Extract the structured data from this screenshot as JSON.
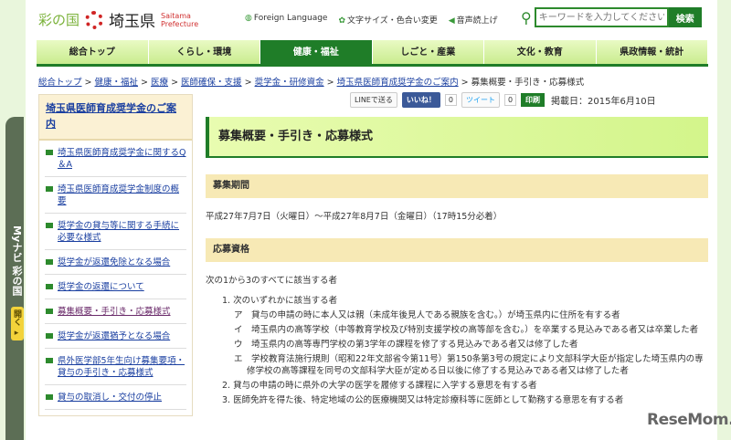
{
  "header": {
    "logo_a": "彩の国",
    "logo_b": "埼玉県",
    "logo_c1": "Saitama",
    "logo_c2": "Prefecture",
    "links": [
      "Foreign Language",
      "文字サイズ・色合い変更",
      "音声読上げ"
    ],
    "search_placeholder": "キーワードを入力してください",
    "search_button": "検索"
  },
  "mynavi": {
    "label": "Myナビ 彩の国",
    "open": "開く ▸"
  },
  "nav": [
    "総合トップ",
    "くらし・環境",
    "健康・福祉",
    "しごと・産業",
    "文化・教育",
    "県政情報・統計"
  ],
  "breadcrumb": [
    "総合トップ",
    "健康・福祉",
    "医療",
    "医師確保・支援",
    "奨学金・研修資金",
    "埼玉県医師育成奨学金のご案内"
  ],
  "breadcrumb_current": "募集概要・手引き・応募様式",
  "share": {
    "line": "LINEで送る",
    "like": "いいね！",
    "like_count": "0",
    "tweet": "ツイート",
    "tweet_count": "0",
    "print": "印刷",
    "date": "掲載日：2015年6月10日"
  },
  "sidebar": {
    "title": "埼玉県医師育成奨学金のご案内",
    "items": [
      "埼玉県医師育成奨学金に関するQ＆A",
      "埼玉県医師育成奨学金制度の概要",
      "奨学金の貸与等に関する手続に必要な様式",
      "奨学金が返還免除となる場合",
      "奨学金の返還について",
      "募集概要・手引き・応募様式",
      "奨学金が返還猶予となる場合",
      "県外医学部5年生向け募集要項・貸与の手引き・応募様式",
      "貸与の取消し・交付の停止"
    ]
  },
  "main": {
    "title": "募集概要・手引き・応募様式",
    "s1": "募集期間",
    "period": "平成27年7月7日（火曜日）～平成27年8月7日（金曜日）（17時15分必着）",
    "s2": "応募資格",
    "intro": "次の1から3のすべてに該当する者",
    "i1": "1. 次のいずれかに該当する者",
    "subs": [
      "ア　貸与の申請の時に本人又は親（未成年後見人である親族を含む。）が埼玉県内に住所を有する者",
      "イ　埼玉県内の高等学校（中等教育学校及び特別支援学校の高等部を含む。）を卒業する見込みである者又は卒業した者",
      "ウ　埼玉県内の高等専門学校の第3学年の課程を修了する見込みである者又は修了した者",
      "エ　学校教育法施行規則（昭和22年文部省令第11号）第150条第3号の規定により文部科学大臣が指定した埼玉県内の専修学校の高等課程を同号の文部科学大臣が定める日以後に修了する見込みである者又は修了した者"
    ],
    "i2": "2. 貸与の申請の時に県外の大学の医学を履修する課程に入学する意思を有する者",
    "i3": "3. 医師免許を得た後、特定地域の公的医療機関又は特定診療科等に医師として勤務する意思を有する者"
  },
  "watermark": "ReseMom."
}
